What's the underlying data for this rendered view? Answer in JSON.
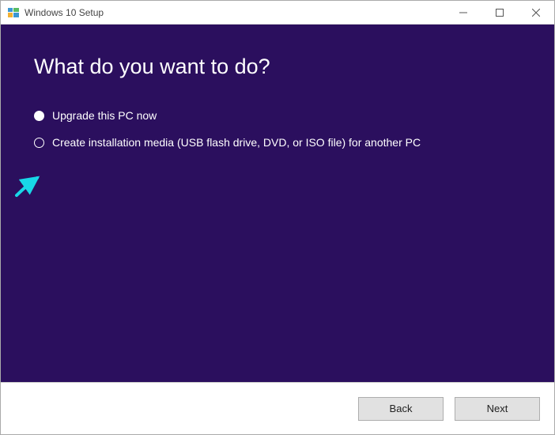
{
  "titlebar": {
    "title": "Windows 10 Setup"
  },
  "content": {
    "heading": "What do you want to do?",
    "options": [
      {
        "label": "Upgrade this PC now",
        "selected": true
      },
      {
        "label": "Create installation media (USB flash drive, DVD, or ISO file) for another PC",
        "selected": false
      }
    ]
  },
  "footer": {
    "back": "Back",
    "next": "Next"
  }
}
